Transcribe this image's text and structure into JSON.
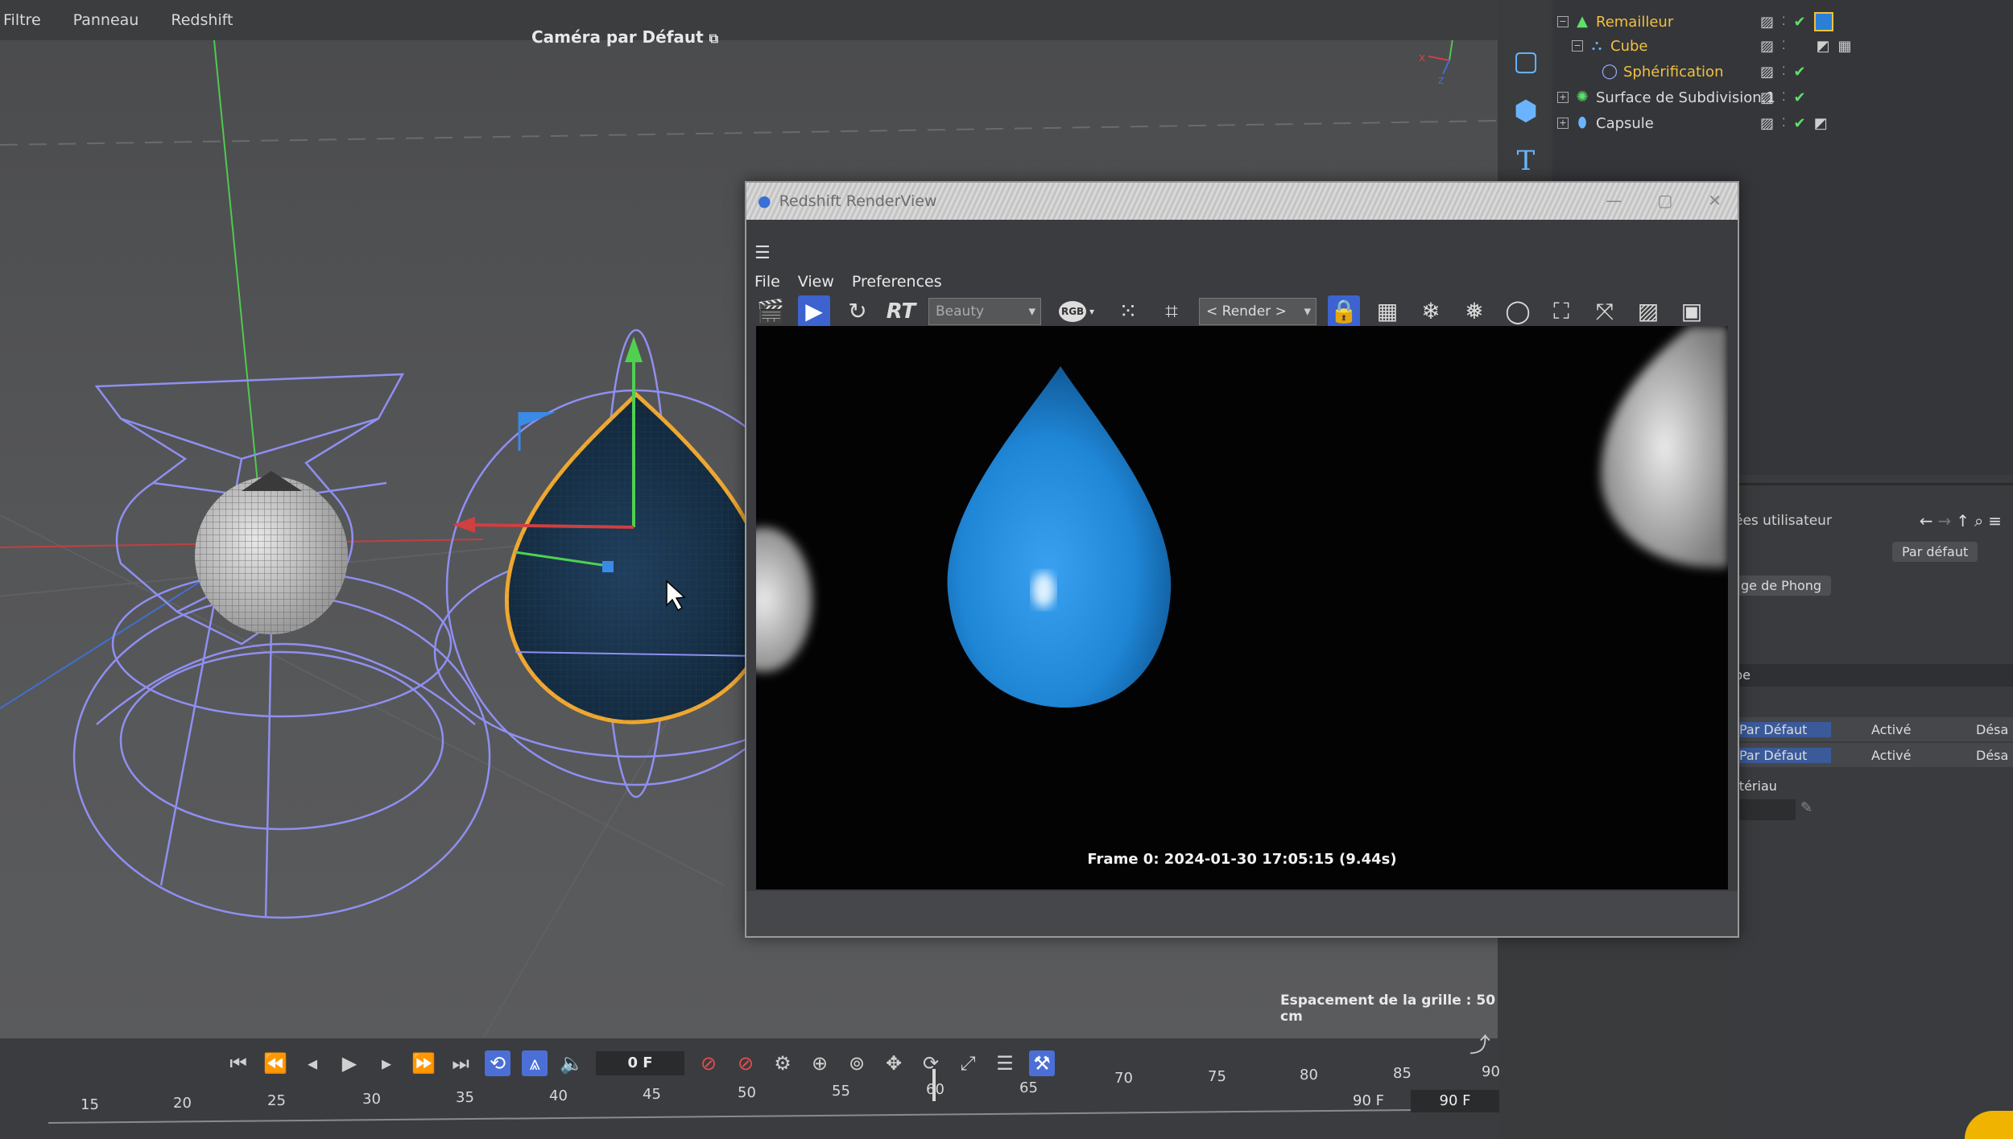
{
  "menubar": {
    "items": [
      "Filtre",
      "Panneau",
      "Redshift"
    ]
  },
  "viewport": {
    "camera_label": "Caméra par Défaut",
    "grid_spacing": "Espacement de la grille : 50 cm"
  },
  "object_manager": {
    "objects": [
      {
        "name": "Remailleur",
        "color": "#f0c040"
      },
      {
        "name": "Cube",
        "color": "#f0c040"
      },
      {
        "name": "Sphérification",
        "color": "#f0c040"
      },
      {
        "name": "Surface de Subdivision.1",
        "color": "#dcdcdc"
      },
      {
        "name": "Capsule",
        "color": "#dcdcdc"
      }
    ]
  },
  "attribute_manager": {
    "header": "ées utilisateur",
    "preset_label": "Par défaut",
    "phong_label": "ge de Phong",
    "section_label": "be",
    "rows": [
      {
        "preset": "Par Défaut",
        "state": "Activé",
        "extra": "Désa"
      },
      {
        "preset": "Par Défaut",
        "state": "Activé",
        "extra": "Désa"
      }
    ],
    "material_label": "atériau"
  },
  "render_view": {
    "title": "Redshift RenderView",
    "menu": [
      "File",
      "View",
      "Preferences"
    ],
    "rt_label": "RT",
    "aov_select": "Beauty",
    "rgb_label": "RGB",
    "render_select": "< Render >",
    "frame_info": "Frame 0:  2024-01-30  17:05:15  (9.44s)"
  },
  "timeline": {
    "current_frame": "0 F",
    "end_frame_label": "90 F",
    "end_frame_field": "90 F",
    "ruler_lower": [
      "15",
      "20",
      "25",
      "30",
      "35",
      "40",
      "45",
      "50",
      "55",
      "60",
      "65"
    ],
    "ruler_upper": [
      "70",
      "75",
      "80",
      "85",
      "90"
    ]
  },
  "colors": {
    "accent_blue": "#4b6fd6",
    "selection_orange": "#f0a830",
    "drop_blue": "#1f86d6"
  }
}
